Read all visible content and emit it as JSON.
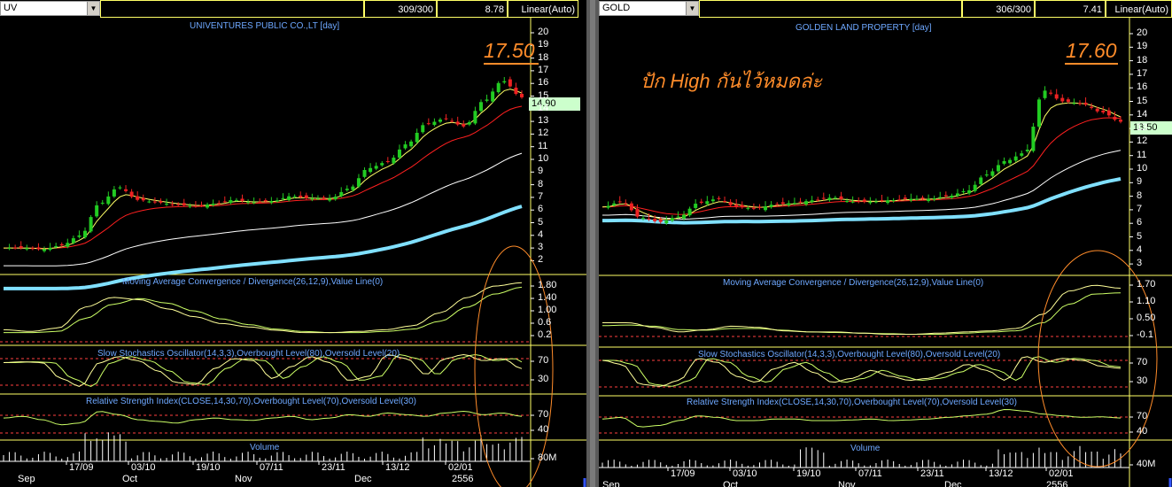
{
  "colors": {
    "grid": "#ffff66",
    "title": "#6ea8ff",
    "ema_fast": "#ffff66",
    "ema_mid": "#ff2020",
    "ema_slow": "#ffffff",
    "ema_long": "#80e0ff",
    "osc_main": "#ccff66",
    "osc_signal": "#ffff99",
    "dash": "#ff4040",
    "annotation": "#ff8c2a",
    "candle_up": "#22cc22",
    "candle_down": "#ee2222"
  },
  "left": {
    "symbol": "UV",
    "count": "309/300",
    "last": "8.78",
    "scale": "Linear(Auto)",
    "chart_title": "UNIVENTURES PUBLIC CO.,LT [day]",
    "price_tag": "14.90",
    "peak_label": "17.50",
    "price_axis": [
      "20",
      "19",
      "18",
      "17",
      "16",
      "15",
      "14",
      "13",
      "12",
      "11",
      "10",
      "9",
      "8",
      "7",
      "6",
      "5",
      "4",
      "3",
      "2"
    ],
    "macd_title": "Moving Average Convergence / Divergence(26,12,9),Value Line(0)",
    "macd_axis": [
      "1.80",
      "1.40",
      "1.00",
      "0.6",
      "0.2"
    ],
    "stoch_title": "Slow Stochastics Oscillator(14,3,3),Overbought Level(80),Oversold Level(20)",
    "stoch_axis": [
      "70",
      "30"
    ],
    "rsi_title": "Relative Strength Index(CLOSE,14,30,70),Overbought Level(70),Oversold Level(30)",
    "rsi_axis": [
      "70",
      "40"
    ],
    "volume_title": "Volume",
    "volume_axis": "80M",
    "dates": [
      "17/09",
      "03/10",
      "19/10",
      "07/11",
      "23/11",
      "13/12",
      "02/01"
    ],
    "months": [
      "Sep",
      "Oct",
      "Nov",
      "Dec",
      "2556"
    ]
  },
  "right": {
    "symbol": "GOLD",
    "count": "306/300",
    "last": "7.41",
    "scale": "Linear(Auto)",
    "chart_title": "GOLDEN LAND PROPERTY [day]",
    "price_tag": "13.50",
    "peak_label": "17.60",
    "annotation": "ปัก High กันไว้หมดล่ะ",
    "price_axis": [
      "20",
      "19",
      "18",
      "17",
      "16",
      "15",
      "14",
      "13",
      "12",
      "11",
      "10",
      "9",
      "8",
      "7",
      "6",
      "5",
      "4",
      "3"
    ],
    "macd_title": "Moving Average Convergence / Divergence(26,12,9),Value Line(0)",
    "macd_axis": [
      "1.70",
      "1.10",
      "0.50",
      "-0.1"
    ],
    "stoch_title": "Slow Stochastics Oscillator(14,3,3),Overbought Level(80),Oversold Level(20)",
    "stoch_axis": [
      "70",
      "30"
    ],
    "rsi_title": "Relative Strength Index(CLOSE,14,30,70),Overbought Level(70),Oversold Level(30)",
    "rsi_axis": [
      "70",
      "40"
    ],
    "volume_title": "Volume",
    "volume_axis": "40M",
    "dates": [
      "17/09",
      "03/10",
      "19/10",
      "07/11",
      "23/11",
      "13/12",
      "02/01"
    ],
    "months": [
      "Sep",
      "Oct",
      "Nov",
      "Dec",
      "2556"
    ]
  },
  "chart_data": [
    {
      "type": "candlestick",
      "title": "UNIVENTURES PUBLIC CO.,LT [day]",
      "x": [
        "17/09",
        "03/10",
        "19/10",
        "07/11",
        "23/11",
        "13/12",
        "02/01"
      ],
      "ylim": [
        2,
        20
      ],
      "close": [
        3.0,
        3.0,
        2.9,
        3.2,
        4.0,
        6.5,
        7.8,
        6.8,
        6.6,
        6.4,
        6.3,
        6.5,
        6.8,
        6.6,
        6.7,
        7.1,
        6.9,
        6.9,
        7.7,
        9.3,
        9.8,
        11.2,
        12.8,
        13.2,
        12.6,
        14.6,
        16.2,
        14.9
      ]
    },
    {
      "type": "candlestick",
      "title": "GOLDEN LAND PROPERTY [day]",
      "x": [
        "17/09",
        "03/10",
        "19/10",
        "07/11",
        "23/11",
        "13/12",
        "02/01"
      ],
      "ylim": [
        3,
        20
      ],
      "close": [
        7.2,
        7.6,
        6.4,
        6.1,
        6.5,
        7.5,
        7.8,
        7.2,
        7.1,
        7.4,
        7.5,
        7.7,
        7.9,
        7.6,
        7.6,
        7.7,
        7.8,
        7.8,
        8.0,
        8.4,
        9.6,
        10.6,
        11.2,
        15.8,
        15.0,
        14.8,
        14.2,
        13.5
      ]
    }
  ]
}
